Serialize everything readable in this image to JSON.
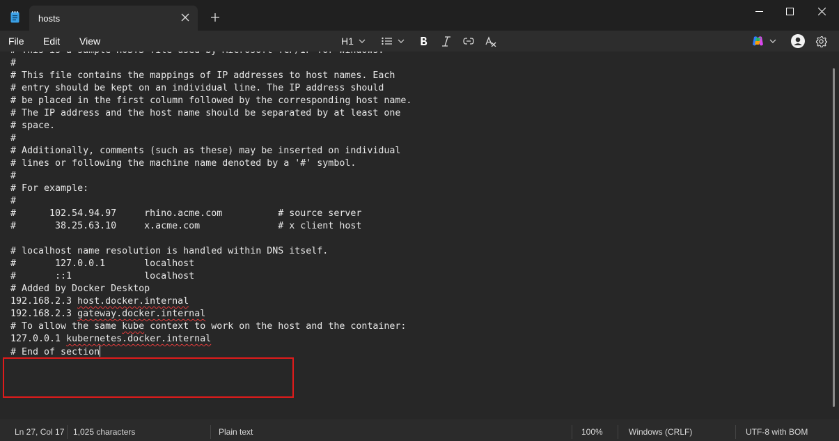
{
  "tab": {
    "title": "hosts"
  },
  "menu": {
    "file": "File",
    "edit": "Edit",
    "view": "View"
  },
  "toolbar": {
    "heading": "H1"
  },
  "icons": {
    "app": "notepad-icon",
    "close_tab": "close-icon",
    "new_tab": "plus-icon",
    "list": "list-icon",
    "bold": "bold-icon",
    "italic": "italic-icon",
    "link": "link-icon",
    "clear_format": "clear-formatting-icon",
    "copilot": "copilot-icon",
    "account": "account-icon",
    "settings": "gear-icon"
  },
  "editor": {
    "lines": [
      "# This is a sample HOSTS file used by Microsoft TCP/IP for Windows.",
      "#",
      "# This file contains the mappings of IP addresses to host names. Each",
      "# entry should be kept on an individual line. The IP address should",
      "# be placed in the first column followed by the corresponding host name.",
      "# The IP address and the host name should be separated by at least one",
      "# space.",
      "#",
      "# Additionally, comments (such as these) may be inserted on individual",
      "# lines or following the machine name denoted by a '#' symbol.",
      "#",
      "# For example:",
      "#",
      "#      102.54.94.97     rhino.acme.com          # source server",
      "#       38.25.63.10     x.acme.com              # x client host",
      "",
      "# localhost name resolution is handled within DNS itself.",
      "#       127.0.0.1       localhost",
      "#       ::1             localhost",
      "# Added by Docker Desktop",
      "192.168.2.3 host.docker.internal",
      "192.168.2.3 gateway.docker.internal",
      "# To allow the same kube context to work on the host and the container:",
      "127.0.0.1 kubernetes.docker.internal",
      "# End of section"
    ],
    "spellcheck_words": [
      "host.docker.internal",
      "gateway.docker.internal",
      "kube",
      "kubernetes.docker.internal"
    ]
  },
  "status": {
    "position": "Ln 27, Col 17",
    "characters": "1,025 characters",
    "mode": "Plain text",
    "zoom": "100%",
    "line_ending": "Windows (CRLF)",
    "encoding": "UTF-8 with BOM"
  },
  "colors": {
    "highlight_box": "#e01b1b",
    "spellcheck": "#e23b3b"
  }
}
